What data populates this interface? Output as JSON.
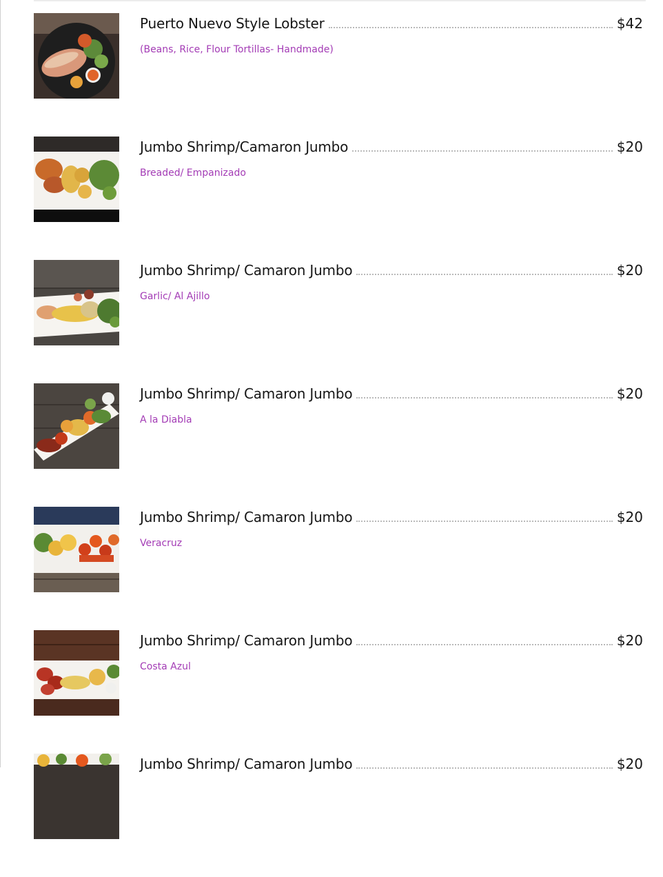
{
  "menu": {
    "items": [
      {
        "name": "Puerto Nuevo Style Lobster",
        "price": "$42",
        "description": "(Beans, Rice, Flour Tortillas- Handmade)",
        "photo": "lobster-plate"
      },
      {
        "name": "Jumbo Shrimp/Camaron Jumbo",
        "price": "$20",
        "description": "Breaded/ Empanizado",
        "photo": "breaded-shrimp-plate"
      },
      {
        "name": "Jumbo Shrimp/ Camaron Jumbo",
        "price": "$20",
        "description": "Garlic/ Al Ajillo",
        "photo": "garlic-shrimp-plate"
      },
      {
        "name": "Jumbo Shrimp/ Camaron Jumbo",
        "price": "$20",
        "description": "A la Diabla",
        "photo": "diabla-shrimp-plate"
      },
      {
        "name": "Jumbo Shrimp/ Camaron Jumbo",
        "price": "$20",
        "description": "Veracruz",
        "photo": "veracruz-shrimp-plate"
      },
      {
        "name": "Jumbo Shrimp/ Camaron Jumbo",
        "price": "$20",
        "description": "Costa Azul",
        "photo": "costa-azul-shrimp-plate"
      },
      {
        "name": "Jumbo Shrimp/ Camaron Jumbo",
        "price": "$20",
        "description": "",
        "photo": "shrimp-plate-partial"
      }
    ]
  },
  "colors": {
    "text": "#161616",
    "description": "#a33bb5",
    "leader": "#b9b9b9"
  }
}
